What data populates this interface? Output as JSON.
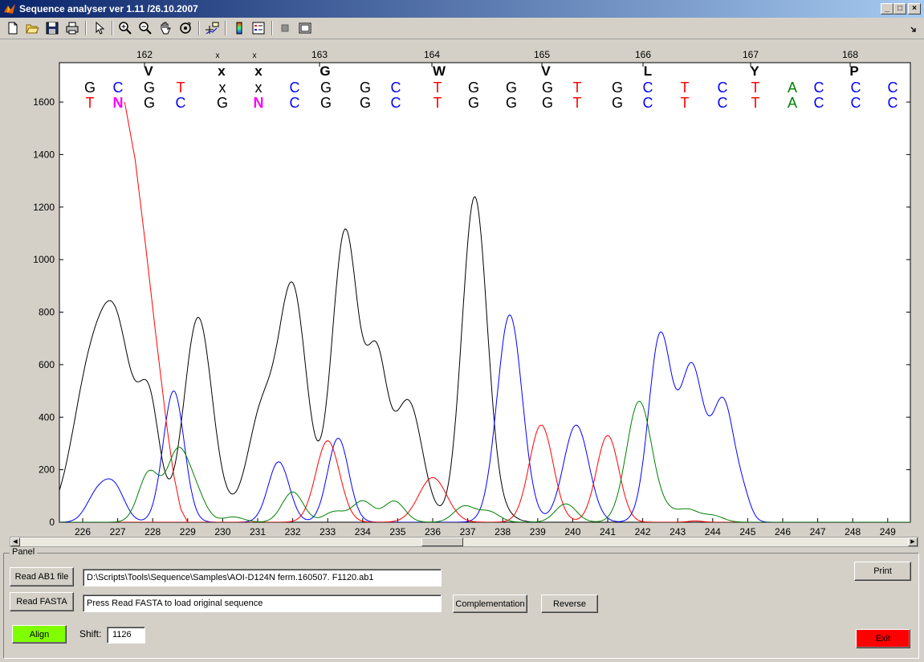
{
  "window": {
    "title": "Sequence analyser ver 1.11 /26.10.2007"
  },
  "toolbar": {
    "icons": [
      "new-file-icon",
      "open-folder-icon",
      "save-icon",
      "print-icon",
      "pointer-icon",
      "zoom-in-icon",
      "zoom-out-icon",
      "pan-hand-icon",
      "rotate-icon",
      "data-cursor-icon",
      "colorbar-icon",
      "legend-icon",
      "gray-square-icon",
      "window-box-icon"
    ]
  },
  "chart_data": {
    "type": "line",
    "title": "",
    "xlabel": "",
    "ylabel": "",
    "ylim": [
      0,
      1750
    ],
    "yticks": [
      0,
      200,
      400,
      600,
      800,
      1000,
      1200,
      1400,
      1600
    ],
    "x_ticks": [
      "226",
      "227",
      "228",
      "229",
      "230",
      "231",
      "232",
      "233",
      "234",
      "235",
      "236",
      "237",
      "238",
      "239",
      "240",
      "241",
      "242",
      "243",
      "244",
      "245",
      "246",
      "247",
      "248",
      "249"
    ],
    "codon_numbers": [
      "162",
      "163",
      "164",
      "165",
      "166",
      "167",
      "168"
    ],
    "amino_acids": [
      "V",
      "x",
      "x",
      "G",
      "W",
      "V",
      "L",
      "Y",
      "P"
    ],
    "x_marks": [
      "x",
      "x"
    ],
    "read_row1": [
      "G",
      "C",
      "G",
      "T",
      "x",
      "x",
      "C",
      "G",
      "G",
      "C",
      "T",
      "G",
      "G",
      "G",
      "T",
      "G",
      "C",
      "T",
      "C",
      "T",
      "A",
      "C",
      "C",
      "C"
    ],
    "read_row2": [
      "T",
      "N",
      "G",
      "C",
      "G",
      "N",
      "C",
      "G",
      "G",
      "C",
      "T",
      "G",
      "G",
      "G",
      "T",
      "G",
      "C",
      "T",
      "C",
      "T",
      "A",
      "C",
      "C",
      "C"
    ],
    "base_colors": {
      "A": "#008000",
      "C": "#0000ff",
      "G": "#000000",
      "T": "#ff0000",
      "N": "#ff00ff",
      "x": "#000000"
    },
    "series": [
      {
        "base": "G",
        "color": "#000000",
        "peaks": [
          [
            0.2,
            540,
            0.5
          ],
          [
            1,
            640,
            0.45
          ],
          [
            1.9,
            430,
            0.3
          ],
          [
            3.3,
            780,
            0.4
          ],
          [
            4.2,
            20,
            0.3
          ],
          [
            5.1,
            400,
            0.4
          ],
          [
            6.0,
            880,
            0.4
          ],
          [
            7.5,
            1110,
            0.38
          ],
          [
            8.4,
            580,
            0.3
          ],
          [
            9.3,
            460,
            0.4
          ],
          [
            11.2,
            1240,
            0.36
          ],
          [
            12.1,
            20,
            0.3
          ]
        ]
      },
      {
        "base": "C",
        "color": "#0000ff",
        "peaks": [
          [
            0.4,
            100,
            0.3
          ],
          [
            0.9,
            130,
            0.3
          ],
          [
            2.6,
            500,
            0.3
          ],
          [
            5.6,
            230,
            0.3
          ],
          [
            7.3,
            320,
            0.3
          ],
          [
            12.2,
            790,
            0.36
          ],
          [
            14.1,
            370,
            0.36
          ],
          [
            16.5,
            710,
            0.33
          ],
          [
            17.4,
            580,
            0.33
          ],
          [
            18.3,
            460,
            0.33
          ],
          [
            18.9,
            60,
            0.2
          ]
        ]
      },
      {
        "base": "T",
        "color": "#ff0000",
        "peaks": [
          [
            7.0,
            310,
            0.34
          ],
          [
            10.0,
            170,
            0.4
          ],
          [
            13.1,
            370,
            0.34
          ],
          [
            15.0,
            330,
            0.32
          ],
          [
            17.5,
            5,
            0.2
          ]
        ]
      },
      {
        "base": "A",
        "color": "#008000",
        "peaks": [
          [
            1.9,
            190,
            0.3
          ],
          [
            2.7,
            250,
            0.3
          ],
          [
            3.2,
            110,
            0.3
          ],
          [
            4.3,
            20,
            0.3
          ],
          [
            6.0,
            115,
            0.3
          ],
          [
            7.2,
            40,
            0.3
          ],
          [
            8.0,
            80,
            0.3
          ],
          [
            8.9,
            80,
            0.3
          ],
          [
            10.9,
            60,
            0.3
          ],
          [
            11.6,
            40,
            0.3
          ],
          [
            13.8,
            70,
            0.3
          ],
          [
            15.9,
            460,
            0.36
          ],
          [
            16.7,
            30,
            0.3
          ],
          [
            17.3,
            45,
            0.3
          ],
          [
            18.0,
            25,
            0.3
          ]
        ]
      }
    ],
    "decay_trace": {
      "base": "T",
      "color": "#ff0000",
      "points": [
        [
          1.2,
          1600
        ],
        [
          1.5,
          1380
        ],
        [
          1.8,
          1050
        ],
        [
          2.1,
          700
        ],
        [
          2.4,
          370
        ],
        [
          2.6,
          180
        ],
        [
          2.8,
          50
        ],
        [
          3.0,
          0
        ]
      ]
    }
  },
  "panel": {
    "label": "Panel",
    "read_ab1_label": "Read AB1 file",
    "read_fasta_label": "Read FASTA",
    "ab1_path": "D:\\Scripts\\Tools\\Sequence\\Samples\\AOI-D124N ferm.160507.  F1120.ab1",
    "fasta_status": "Press Read FASTA to load original sequence",
    "complementation_label": "Complementation",
    "reverse_label": "Reverse",
    "align_label": "Align",
    "align_color": "#80ff00",
    "shift_label": "Shift:",
    "shift_value": "1126",
    "print_label": "Print",
    "exit_label": "Exit",
    "exit_color": "#ff0000"
  }
}
